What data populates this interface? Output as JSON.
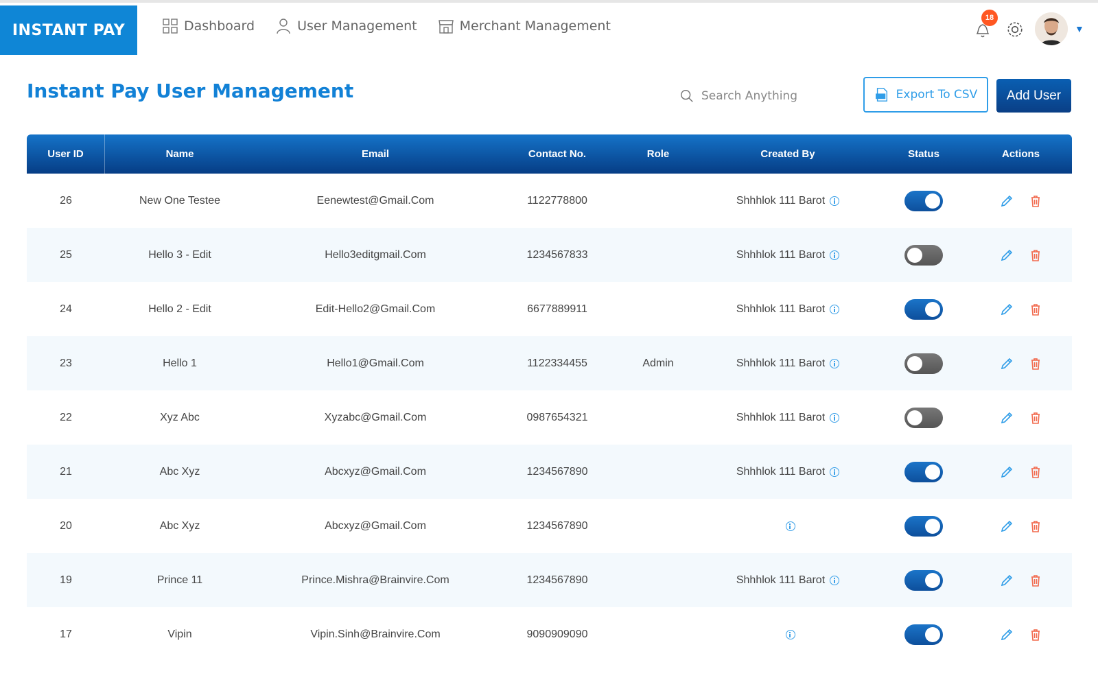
{
  "brand": "INSTANT PAY",
  "nav": [
    {
      "label": "Dashboard",
      "icon": "dashboard-icon"
    },
    {
      "label": "User Management",
      "icon": "user-icon"
    },
    {
      "label": "Merchant Management",
      "icon": "store-icon"
    }
  ],
  "notifications": {
    "count": "18"
  },
  "page_title": "Instant Pay User Management",
  "search": {
    "placeholder": "Search Anything"
  },
  "export_label": "Export To CSV",
  "add_user_label": "Add User",
  "columns": [
    "User ID",
    "Name",
    "Email",
    "Contact No.",
    "Role",
    "Created By",
    "Status",
    "Actions"
  ],
  "rows": [
    {
      "id": "26",
      "name": "New One Testee",
      "email": "Eenewtest@Gmail.Com",
      "contact": "1122778800",
      "role": "",
      "created_by": "Shhhlok 111 Barot",
      "status": "on"
    },
    {
      "id": "25",
      "name": "Hello 3 - Edit",
      "email": "Hello3editgmail.Com",
      "contact": "1234567833",
      "role": "",
      "created_by": "Shhhlok 111 Barot",
      "status": "off"
    },
    {
      "id": "24",
      "name": "Hello 2 - Edit",
      "email": "Edit-Hello2@Gmail.Com",
      "contact": "6677889911",
      "role": "",
      "created_by": "Shhhlok 111 Barot",
      "status": "on"
    },
    {
      "id": "23",
      "name": "Hello 1",
      "email": "Hello1@Gmail.Com",
      "contact": "1122334455",
      "role": "Admin",
      "created_by": "Shhhlok 111 Barot",
      "status": "off"
    },
    {
      "id": "22",
      "name": "Xyz Abc",
      "email": "Xyzabc@Gmail.Com",
      "contact": "0987654321",
      "role": "",
      "created_by": "Shhhlok 111 Barot",
      "status": "off"
    },
    {
      "id": "21",
      "name": "Abc Xyz",
      "email": "Abcxyz@Gmail.Com",
      "contact": "1234567890",
      "role": "",
      "created_by": "Shhhlok 111 Barot",
      "status": "on"
    },
    {
      "id": "20",
      "name": "Abc Xyz",
      "email": "Abcxyz@Gmail.Com",
      "contact": "1234567890",
      "role": "",
      "created_by": "",
      "status": "on"
    },
    {
      "id": "19",
      "name": "Prince 11",
      "email": "Prince.Mishra@Brainvire.Com",
      "contact": "1234567890",
      "role": "",
      "created_by": "Shhhlok 111 Barot",
      "status": "on"
    },
    {
      "id": "17",
      "name": "Vipin",
      "email": "Vipin.Sinh@Brainvire.Com",
      "contact": "9090909090",
      "role": "",
      "created_by": "",
      "status": "on"
    }
  ],
  "colors": {
    "brand": "#0f86d6",
    "header_gradient_top": "#1573c8",
    "header_gradient_bottom": "#063d85",
    "title": "#1281d6",
    "delete": "#f26b4f",
    "edit": "#2f9de8"
  }
}
